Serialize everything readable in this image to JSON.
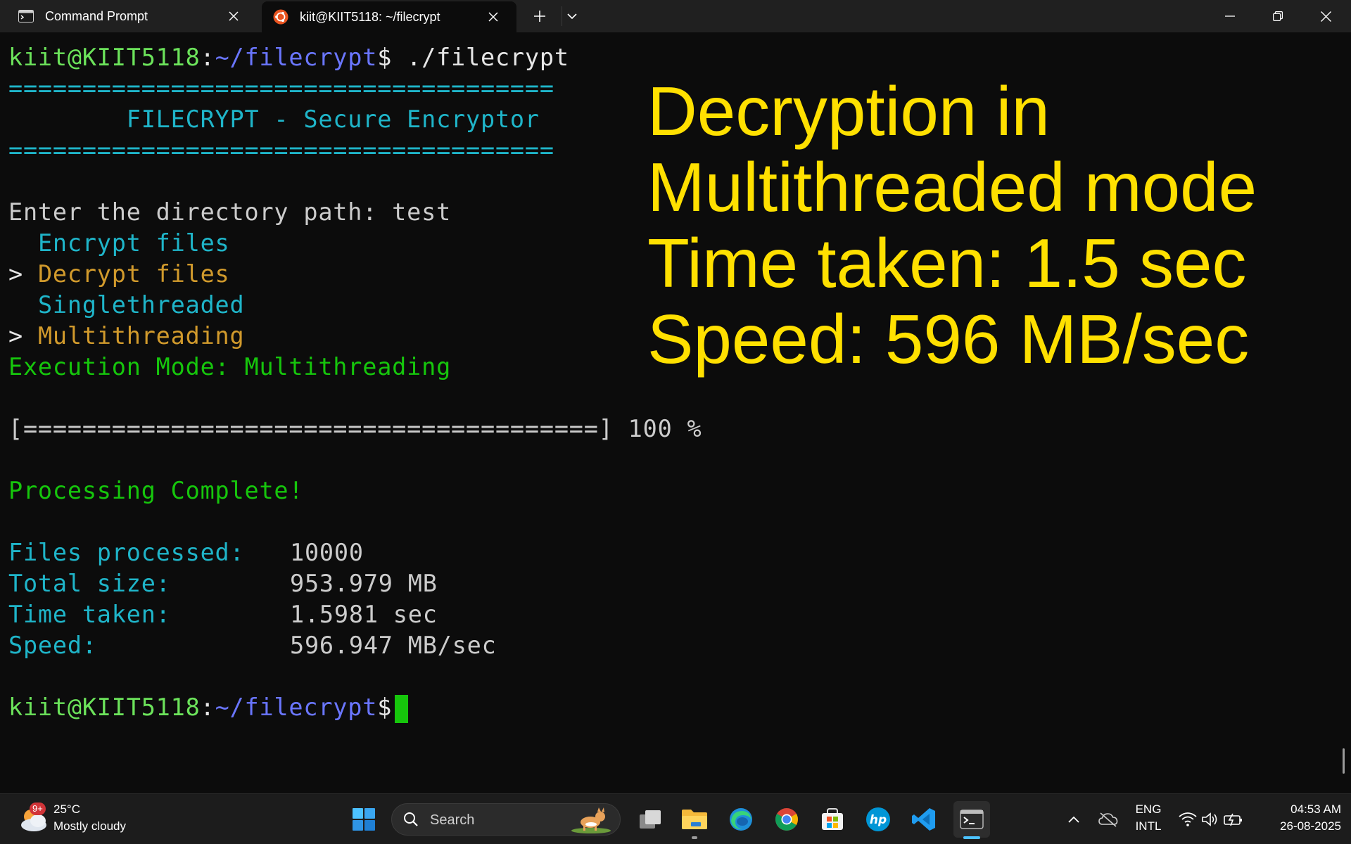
{
  "window": {
    "tabs": [
      {
        "label": "Command Prompt",
        "icon": "cmd-icon"
      },
      {
        "label": "kiit@KIIT5118: ~/filecrypt",
        "icon": "ubuntu-icon"
      }
    ]
  },
  "terminal": {
    "prompt_user": "kiit@KIIT5118",
    "prompt_colon": ":",
    "prompt_path": "~/filecrypt",
    "prompt_symbol": "$",
    "command": " ./filecrypt",
    "rule": "=====================================",
    "banner_title": "        FILECRYPT - Secure Encryptor",
    "dir_prompt": "Enter the directory path: test",
    "menu": [
      {
        "marker": "  ",
        "label": "Encrypt files"
      },
      {
        "marker": "> ",
        "label": "Decrypt files"
      },
      {
        "marker": "  ",
        "label": "Singlethreaded"
      },
      {
        "marker": "> ",
        "label": "Multithreading"
      }
    ],
    "execution_mode": "Execution Mode: Multithreading",
    "progress_bar": "[=======================================]",
    "progress_text": " 100 %",
    "progress_fraction": 1.0,
    "complete_message": "Processing Complete!",
    "stats": [
      {
        "label": "Files processed:",
        "value": "10000"
      },
      {
        "label": "Total size:",
        "value": "953.979 MB"
      },
      {
        "label": "Time taken:",
        "value": "1.5981 sec"
      },
      {
        "label": "Speed:",
        "value": "596.947 MB/sec"
      }
    ]
  },
  "overlay": {
    "lines": [
      "Decryption in",
      "Multithreaded mode",
      "Time taken: 1.5 sec",
      "Speed: 596 MB/sec"
    ],
    "color": "#ffe000"
  },
  "taskbar": {
    "weather_temp": "25°C",
    "weather_desc": "Mostly cloudy",
    "weather_badge": "9+",
    "search_placeholder": "Search",
    "language_line1": "ENG",
    "language_line2": "INTL",
    "time": "04:53 AM",
    "date": "26-08-2025",
    "pinned_icons": [
      "windows-start-icon",
      "task-view-icon",
      "file-explorer-icon",
      "edge-icon",
      "chrome-icon",
      "microsoft-store-icon",
      "hp-icon",
      "vscode-icon",
      "terminal-icon"
    ]
  },
  "colors": {
    "prompt_user": "#6ce35b",
    "prompt_path": "#6a76ff",
    "menu_selected": "#d19a2c",
    "menu_unselected": "#1fb5c9",
    "success": "#16c60c",
    "accent": "#4cc2ff"
  }
}
